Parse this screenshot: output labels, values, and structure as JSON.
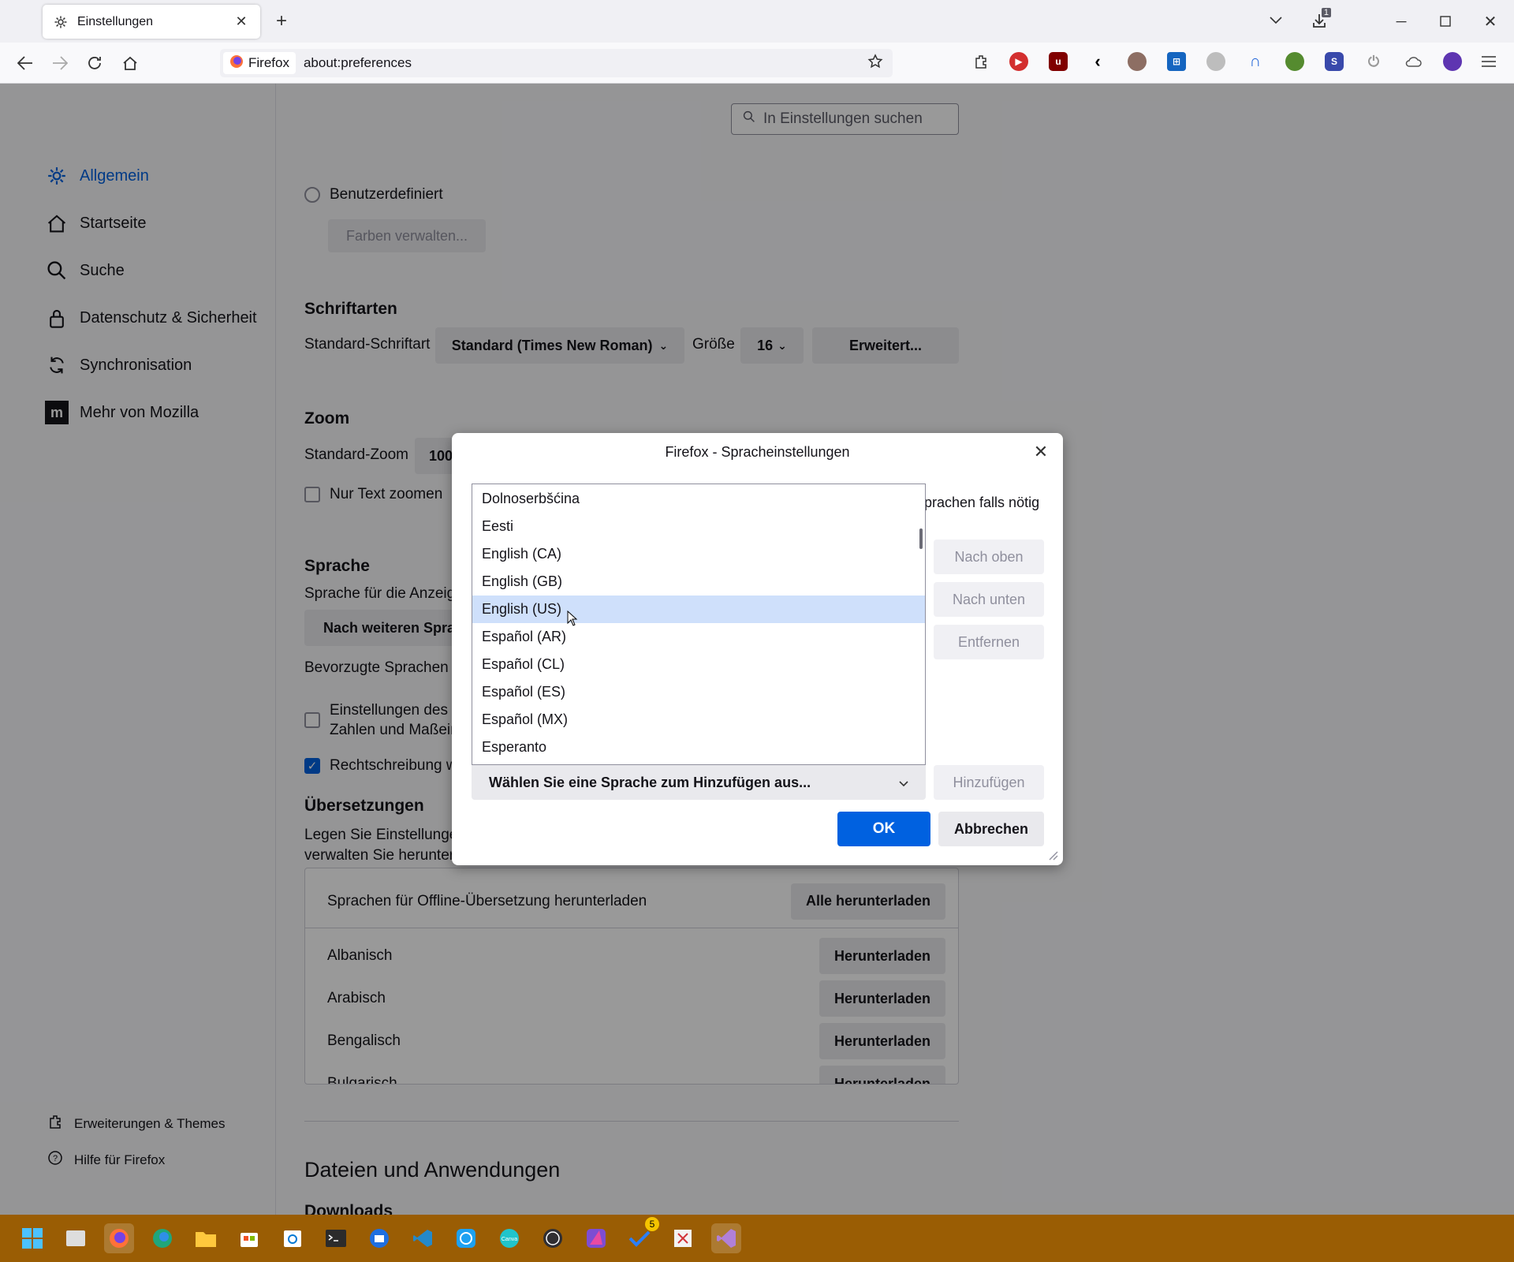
{
  "browser": {
    "tab_title": "Einstellungen",
    "identity_label": "Firefox",
    "url": "about:preferences",
    "downloads_badge": "1"
  },
  "sidebar": {
    "items": [
      {
        "label": "Allgemein",
        "icon": "gear-icon",
        "active": true
      },
      {
        "label": "Startseite",
        "icon": "home-icon"
      },
      {
        "label": "Suche",
        "icon": "search-icon"
      },
      {
        "label": "Datenschutz & Sicherheit",
        "icon": "lock-icon"
      },
      {
        "label": "Synchronisation",
        "icon": "sync-icon"
      },
      {
        "label": "Mehr von Mozilla",
        "icon": "mozilla-icon"
      }
    ],
    "extensions_label": "Erweiterungen & Themes",
    "help_label": "Hilfe für Firefox"
  },
  "main": {
    "search_placeholder": "In Einstellungen suchen",
    "custom_radio_label": "Benutzerdefiniert",
    "manage_colors_label": "Farben verwalten...",
    "fonts": {
      "heading": "Schriftarten",
      "default_font_label": "Standard-Schriftart",
      "default_font_value": "Standard (Times New Roman)",
      "size_label": "Größe",
      "size_value": "16",
      "advanced_label": "Erweitert..."
    },
    "zoom": {
      "heading": "Zoom",
      "default_zoom_label": "Standard-Zoom",
      "default_zoom_value": "100",
      "text_only_label": "Nur Text zoomen"
    },
    "language": {
      "heading": "Sprache",
      "display_label": "Sprache für die Anzeig",
      "search_more_button": "Nach weiteren Spra",
      "preferred_label": "Bevorzugte Sprachen f",
      "regional_line1": "Einstellungen des E",
      "regional_line2": "Zahlen und Maßein",
      "spellcheck_label": "Rechtschreibung w"
    },
    "translations": {
      "heading": "Übersetzungen",
      "desc_line1": "Legen Sie Einstellungen",
      "desc_line2": "verwalten Sie herunter",
      "offline_label": "Sprachen für Offline-Übersetzung herunterladen",
      "download_all": "Alle herunterladen",
      "rows": [
        {
          "name": "Albanisch",
          "button": "Herunterladen"
        },
        {
          "name": "Arabisch",
          "button": "Herunterladen"
        },
        {
          "name": "Bengalisch",
          "button": "Herunterladen"
        },
        {
          "name": "Bulgarisch",
          "button": "Herunterladen"
        }
      ]
    },
    "files_heading": "Dateien und Anwendungen",
    "downloads_heading": "Downloads"
  },
  "dialog": {
    "title": "Firefox - Spracheinstellungen",
    "partial_text": "prachen falls nötig",
    "languages": [
      {
        "label": "Dolnoserbšćina"
      },
      {
        "label": "Eesti"
      },
      {
        "label": "English (CA)"
      },
      {
        "label": "English (GB)"
      },
      {
        "label": "English (US)",
        "selected": true
      },
      {
        "label": "Español (AR)"
      },
      {
        "label": "Español (CL)"
      },
      {
        "label": "Español (ES)"
      },
      {
        "label": "Español (MX)"
      },
      {
        "label": "Esperanto"
      }
    ],
    "move_up": "Nach oben",
    "move_down": "Nach unten",
    "remove": "Entfernen",
    "select_placeholder": "Wählen Sie eine Sprache zum Hinzufügen aus...",
    "add": "Hinzufügen",
    "ok": "OK",
    "cancel": "Abbrechen"
  },
  "taskbar": {
    "apps": [
      "windows-start-icon",
      "file-explorer-alt-icon",
      "firefox-icon",
      "edge-icon",
      "folder-icon",
      "store-icon",
      "calendar-icon",
      "terminal-icon",
      "thunderbird-icon",
      "vscode-icon",
      "app-icon",
      "canva-icon",
      "obs-icon",
      "affinity-icon",
      "todo-icon",
      "snipping-icon",
      "visual-studio-icon"
    ],
    "todo_badge": "5"
  },
  "colors": {
    "accent": "#0061e0",
    "selection": "#cfe0fb",
    "taskbar": "#9a5d04"
  }
}
